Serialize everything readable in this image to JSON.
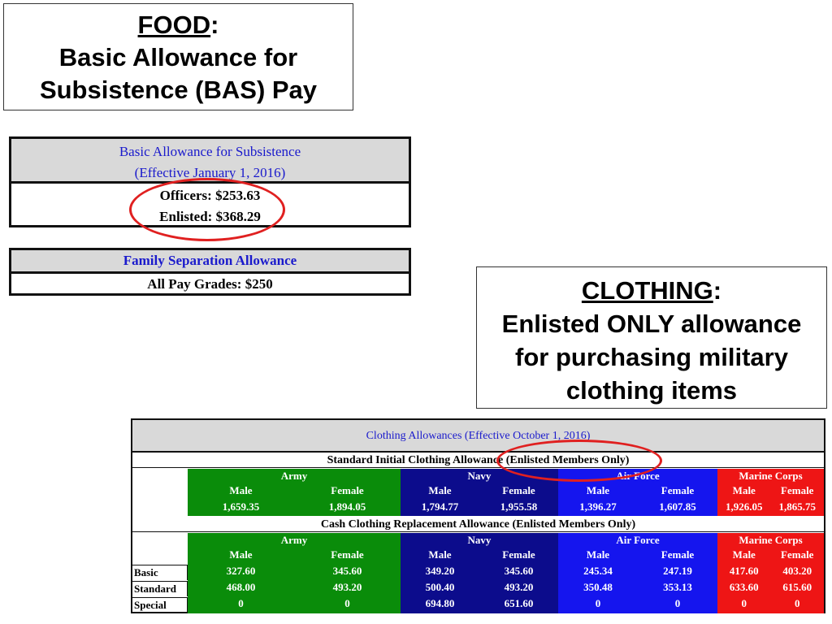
{
  "food_callout": {
    "head": "FOOD",
    "colon": ":",
    "line1": "Basic Allowance for",
    "line2": "Subsistence (BAS) Pay"
  },
  "clothing_callout": {
    "head": "CLOTHING",
    "colon": ":",
    "line1": "Enlisted ONLY allowance",
    "line2": "for purchasing military",
    "line3": "clothing items"
  },
  "bas_table": {
    "title1": "Basic Allowance for Subsistence",
    "title2": "(Effective January 1, 2016)",
    "officers": "Officers:  $253.63",
    "enlisted": "Enlisted:  $368.29"
  },
  "fsa_table": {
    "title": "Family Separation Allowance",
    "value": "All Pay Grades:  $250"
  },
  "clothing_table": {
    "title": "Clothing Allowances (Effective October 1, 2016)",
    "initial_title": "Standard Initial Clothing Allowance (Enlisted Members Only)",
    "replacement_title": "Cash Clothing Replacement Allowance (Enlisted Members Only)",
    "services": [
      "Army",
      "Navy",
      "Air Force",
      "Marine Corps"
    ],
    "sex": {
      "male": "Male",
      "female": "Female"
    },
    "initial": [
      "1,659.35",
      "1,894.05",
      "1,794.77",
      "1,955.58",
      "1,396.27",
      "1,607.85",
      "1,926.05",
      "1,865.75"
    ],
    "rows": [
      {
        "label": "Basic",
        "values": [
          "327.60",
          "345.60",
          "349.20",
          "345.60",
          "245.34",
          "247.19",
          "417.60",
          "403.20"
        ]
      },
      {
        "label": "Standard",
        "values": [
          "468.00",
          "493.20",
          "500.40",
          "493.20",
          "350.48",
          "353.13",
          "633.60",
          "615.60"
        ]
      },
      {
        "label": "Special",
        "values": [
          "0",
          "0",
          "694.80",
          "651.60",
          "0",
          "0",
          "0",
          "0"
        ]
      }
    ]
  },
  "colors": {
    "army": "#0a8c0a",
    "navy": "#0c0c8c",
    "airforce": "#1515ee",
    "marines": "#ee1515",
    "highlight": "#e02020"
  }
}
